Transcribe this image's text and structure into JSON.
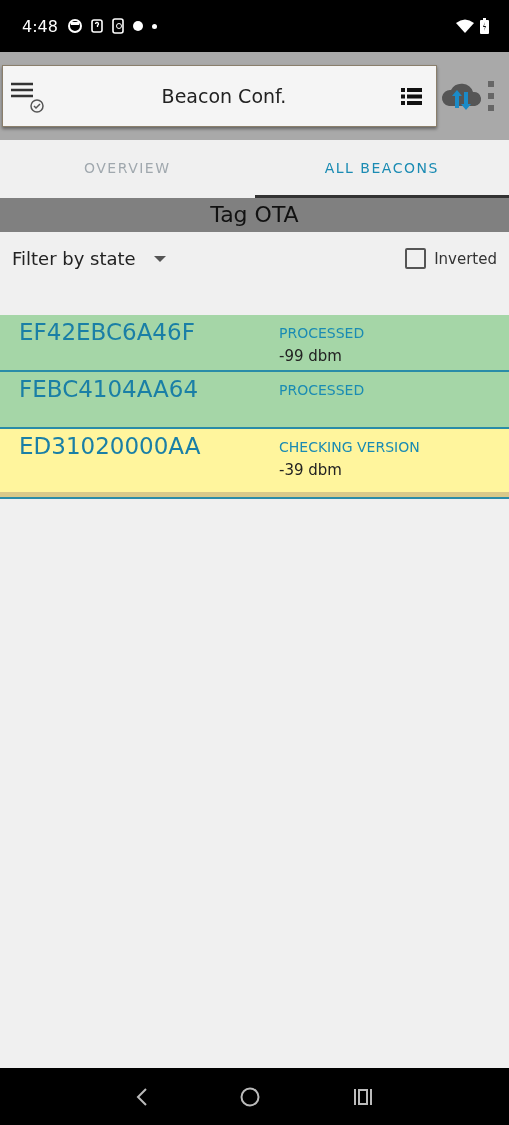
{
  "status_bar": {
    "time": "4:48"
  },
  "app_bar": {
    "title": "Beacon Conf."
  },
  "tabs": [
    {
      "label": "OVERVIEW",
      "selected": false
    },
    {
      "label": "ALL BEACONS",
      "selected": true
    }
  ],
  "section_title": "Tag OTA",
  "filter": {
    "label": "Filter by state",
    "inverted_label": "Inverted",
    "inverted_checked": false
  },
  "beacons": [
    {
      "id": "EF42EBC6A46F",
      "state": "PROCESSED",
      "rssi": "-99 dbm",
      "color": "#a5d6a7"
    },
    {
      "id": "FEBC4104AA64",
      "state": "PROCESSED",
      "color": "#a5d6a7"
    },
    {
      "id": "ED31020000AA",
      "state": "CHECKING VERSION",
      "rssi": "-39 dbm",
      "color": "#fff59d"
    }
  ]
}
